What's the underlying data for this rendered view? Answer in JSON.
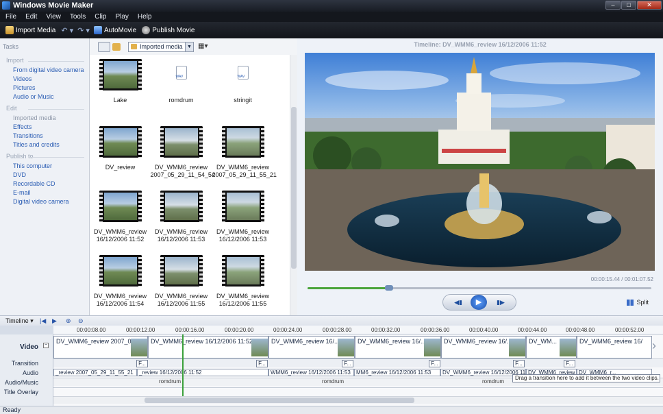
{
  "window": {
    "title": "Windows Movie Maker"
  },
  "menu": [
    "File",
    "Edit",
    "View",
    "Tools",
    "Clip",
    "Play",
    "Help"
  ],
  "toolbar": {
    "import": "Import Media",
    "automovie": "AutoMovie",
    "publish": "Publish Movie"
  },
  "tasks": {
    "header": "Tasks",
    "import_label": "Import",
    "import_items": [
      "From digital video camera",
      "Videos",
      "Pictures",
      "Audio or Music"
    ],
    "edit_label": "Edit",
    "edit_items": [
      "Imported media",
      "Effects",
      "Transitions",
      "Titles and credits"
    ],
    "publish_label": "Publish to",
    "publish_items": [
      "This computer",
      "DVD",
      "Recordable CD",
      "E-mail",
      "Digital video camera"
    ]
  },
  "collection": {
    "dropdown": "Imported media",
    "items": [
      {
        "name": "Lake",
        "type": "video"
      },
      {
        "name": "romdrum",
        "type": "audio"
      },
      {
        "name": "stringit",
        "type": "audio"
      },
      {
        "name": "DV_review",
        "type": "video"
      },
      {
        "name": "DV_WMM6_review\n2007_05_29_11_54_54",
        "type": "video"
      },
      {
        "name": "DV_WMM6_review\n2007_05_29_11_55_21",
        "type": "video"
      },
      {
        "name": "DV_WMM6_review\n16/12/2006 11:52",
        "type": "video"
      },
      {
        "name": "DV_WMM6_review\n16/12/2006 11:53",
        "type": "video"
      },
      {
        "name": "DV_WMM6_review\n16/12/2006 11:53",
        "type": "video"
      },
      {
        "name": "DV_WMM6_review\n16/12/2006 11:54",
        "type": "video"
      },
      {
        "name": "DV_WMM6_review\n16/12/2006 11:55",
        "type": "video"
      },
      {
        "name": "DV_WMM6_review\n16/12/2006 11:55",
        "type": "video"
      }
    ]
  },
  "preview": {
    "title": "Timeline: DV_WMM6_review 16/12/2006 11:52",
    "time": "00:00:15.44 / 00:01:07.52",
    "split": "Split",
    "progress": 0.24
  },
  "timeline": {
    "label": "Timeline",
    "ruler": [
      "00:00:08.00",
      "00:00:12.00",
      "00:00:16.00",
      "00:00:20.00",
      "00:00:24.00",
      "00:00:28.00",
      "00:00:32.00",
      "00:00:36.00",
      "00:00:40.00",
      "00:00:44.00",
      "00:00:48.00",
      "00:00:52.00"
    ],
    "tracks": [
      "Video",
      "Transition",
      "Audio",
      "Audio/Music",
      "Title Overlay"
    ],
    "video_clips": [
      "DV_WMM6_review 2007_05_29...",
      "DV_WMM6_review 16/12/2006 11:52",
      "DV_WMM6_review 16/...",
      "DV_WMM6_review 16/...",
      "DV_WMM6_review 16/...",
      "DV_WM...",
      "DV_WMM6_review 16/"
    ],
    "transition_chip": "F...",
    "audio_clips": [
      "_review 2007_05_29_11_55_21",
      "_review 16/12/2006 11:52",
      "WMM6_review 16/12/2006 11:53",
      "MM6_review 16/12/2006 11:53",
      "DV_WMM6_review 16/12/2006 11:54",
      "DV_WMM6_review 16/12/2006 11:55",
      "DV_WMM6_r..."
    ],
    "music": [
      "romdrum",
      "romdrum",
      "romdrum"
    ],
    "tooltip": "Drag a transition here to add it between the two video clips."
  },
  "status": "Ready"
}
